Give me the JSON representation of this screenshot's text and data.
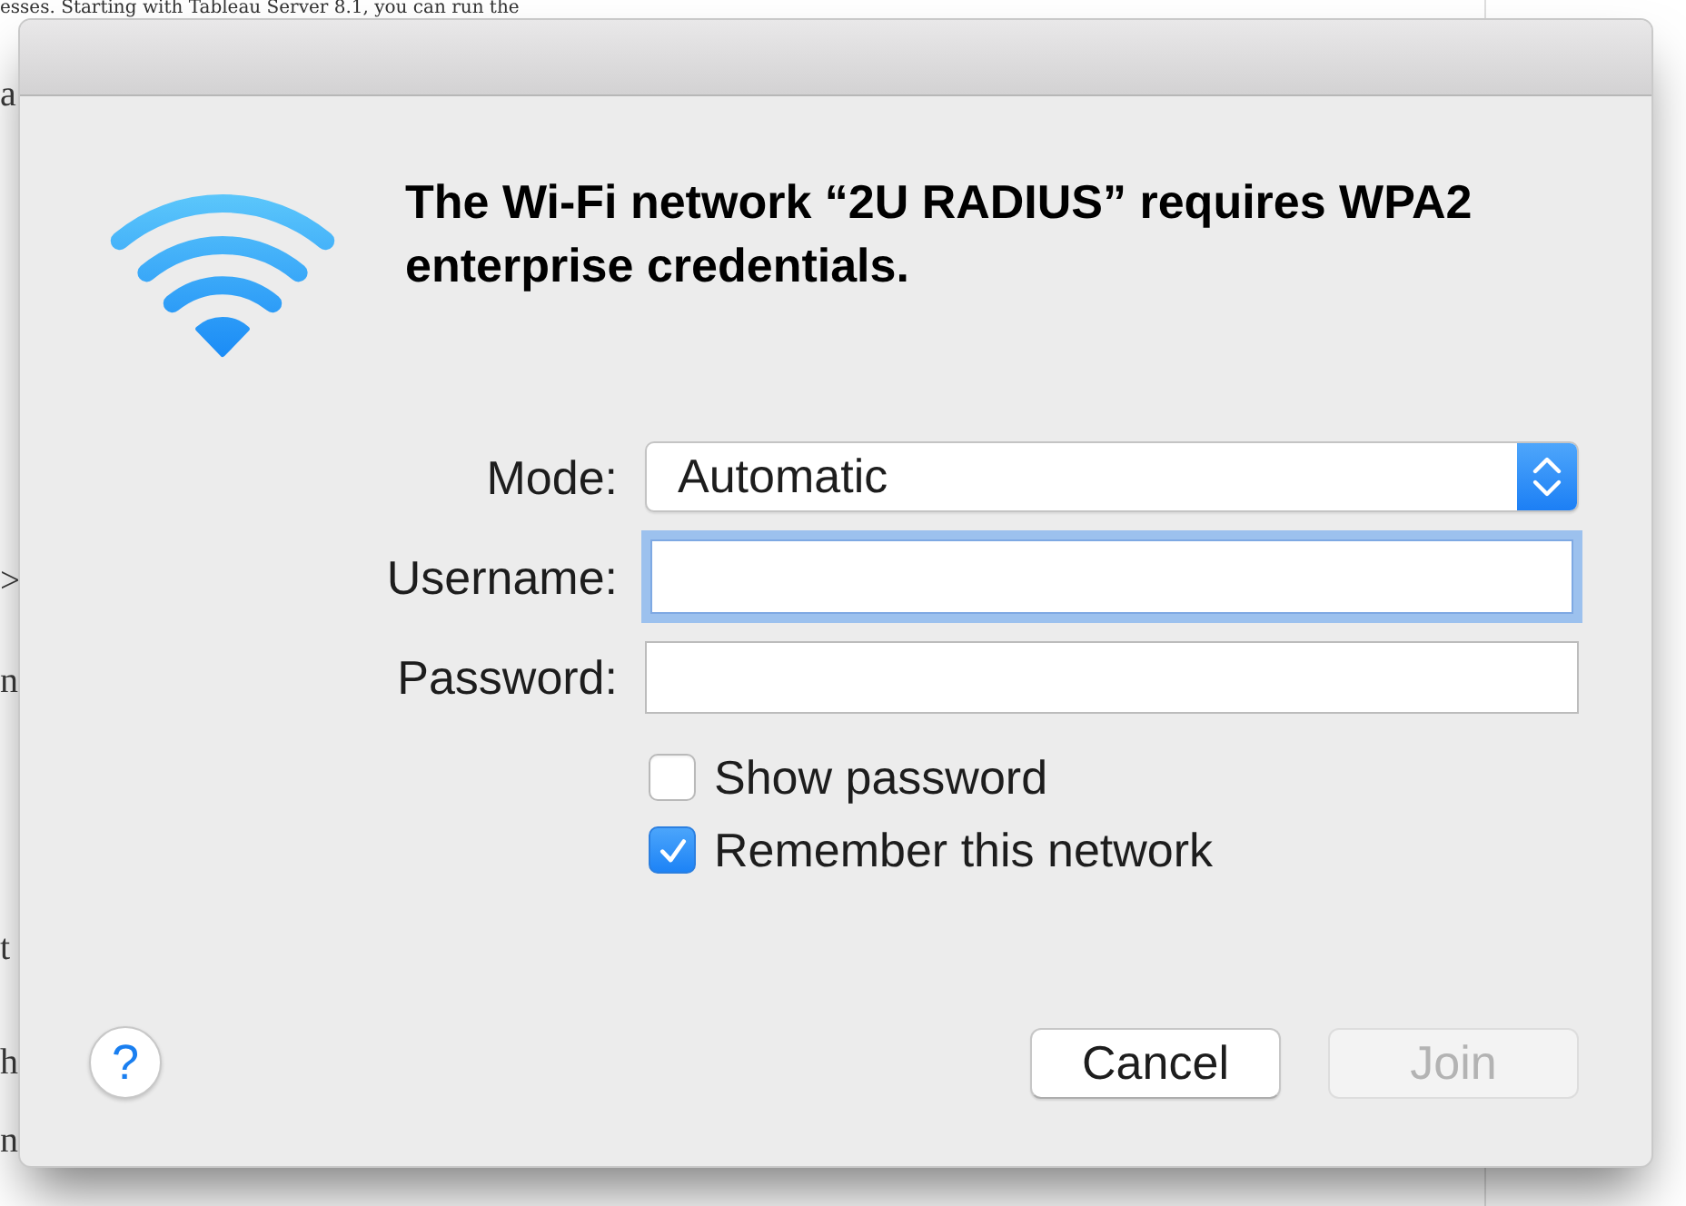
{
  "background": {
    "lines": [
      "esses. Starting with Tableau Server 8.1, you can run the",
      "a",
      ">",
      "n",
      "t",
      "h",
      "n"
    ]
  },
  "dialog": {
    "heading": "The Wi-Fi network “2U RADIUS” requires WPA2 enterprise credentials.",
    "fields": [
      {
        "kind": "select",
        "label": "Mode:",
        "value": "Automatic"
      },
      {
        "kind": "text",
        "label": "Username:",
        "focused": true
      },
      {
        "kind": "password",
        "label": "Password:",
        "focused": false
      }
    ],
    "checkboxes": [
      {
        "label": "Show password",
        "checked": false
      },
      {
        "label": "Remember this network",
        "checked": true
      }
    ],
    "help_button": "?",
    "buttons": [
      {
        "label": "Cancel",
        "disabled": false
      },
      {
        "label": "Join",
        "disabled": true
      }
    ]
  }
}
